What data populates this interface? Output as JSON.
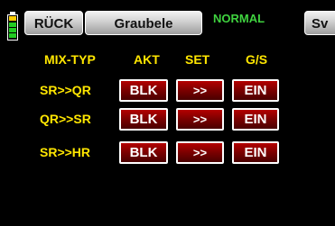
{
  "header": {
    "back_label": "RÜCK",
    "model_name": "Graubele",
    "mode": "NORMAL",
    "sv_label": "Sv"
  },
  "columns": {
    "type": "MIX-TYP",
    "akt": "AKT",
    "set": "SET",
    "gs": "G/S"
  },
  "rows": [
    {
      "label": "SR>>QR",
      "akt": "BLK",
      "set": ">>",
      "gs": "EIN"
    },
    {
      "label": "QR>>SR",
      "akt": "BLK",
      "set": ">>",
      "gs": "EIN"
    },
    {
      "label": "SR>>HR",
      "akt": "BLK",
      "set": ">>",
      "gs": "EIN"
    }
  ],
  "colors": {
    "background": "#000000",
    "label": "#ffe600",
    "mode": "#3fd23f",
    "button_red": "#8b0000"
  },
  "icons": {
    "battery": "battery-icon"
  }
}
